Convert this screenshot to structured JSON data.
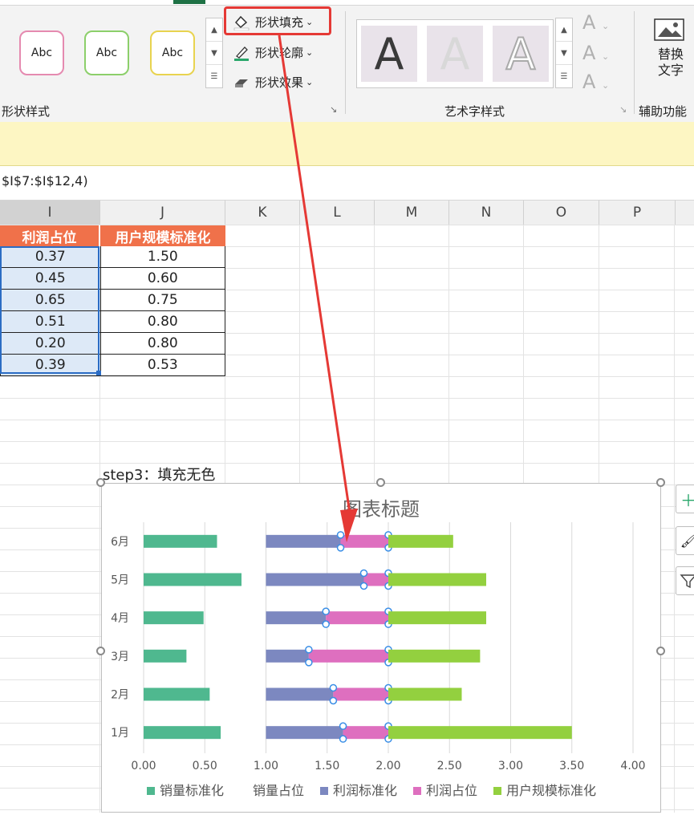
{
  "ribbon": {
    "style_presets": [
      "Abc",
      "Abc",
      "Abc"
    ],
    "commands": {
      "shape_fill": "形状填充",
      "shape_outline": "形状轮廓",
      "shape_effects": "形状效果"
    },
    "group_shape_styles": "形状样式",
    "wordart_letter": "A",
    "group_wordart": "艺术字样式",
    "alt_text": "替换文字",
    "alt_text_line1": "替换",
    "alt_text_line2": "文字",
    "group_accessibility": "辅助功能",
    "colors": {
      "highlight": "#e53935",
      "fill_icon": "#2aa76b"
    }
  },
  "formula_bar": {
    "text": "$I$7:$I$12,4)"
  },
  "columns": [
    "I",
    "J",
    "K",
    "L",
    "M",
    "N",
    "O",
    "P"
  ],
  "table": {
    "headers": [
      "利润占位",
      "用户规模标准化"
    ],
    "rows": [
      [
        "0.37",
        "1.50"
      ],
      [
        "0.45",
        "0.60"
      ],
      [
        "0.65",
        "0.75"
      ],
      [
        "0.51",
        "0.80"
      ],
      [
        "0.20",
        "0.80"
      ],
      [
        "0.39",
        "0.53"
      ]
    ],
    "header_color": "#f0714a"
  },
  "annotation": "step3：填充无色",
  "chart_data": {
    "type": "bar",
    "title": "图表标题",
    "orientation": "horizontal",
    "categories": [
      "1月",
      "2月",
      "3月",
      "4月",
      "5月",
      "6月"
    ],
    "xlim": [
      0,
      4
    ],
    "xticks": [
      "0.00",
      "0.50",
      "1.00",
      "1.50",
      "2.00",
      "2.50",
      "3.00",
      "3.50",
      "4.00"
    ],
    "stacked": true,
    "legend_position": "bottom",
    "series": [
      {
        "name": "销量标准化",
        "color": "#4fb88f",
        "values": [
          0.63,
          0.54,
          0.35,
          0.49,
          0.8,
          0.6
        ]
      },
      {
        "name": "销量占位",
        "color": "none",
        "values": [
          0.37,
          0.46,
          0.65,
          0.51,
          0.2,
          0.4
        ]
      },
      {
        "name": "利润标准化",
        "color": "#7c88c0",
        "values": [
          0.63,
          0.55,
          0.35,
          0.49,
          0.8,
          0.61
        ]
      },
      {
        "name": "利润占位",
        "color": "#de6fbf",
        "values": [
          0.37,
          0.45,
          0.65,
          0.51,
          0.2,
          0.39
        ]
      },
      {
        "name": "用户规模标准化",
        "color": "#93d03f",
        "values": [
          1.5,
          0.6,
          0.75,
          0.8,
          0.8,
          0.53
        ]
      }
    ]
  }
}
